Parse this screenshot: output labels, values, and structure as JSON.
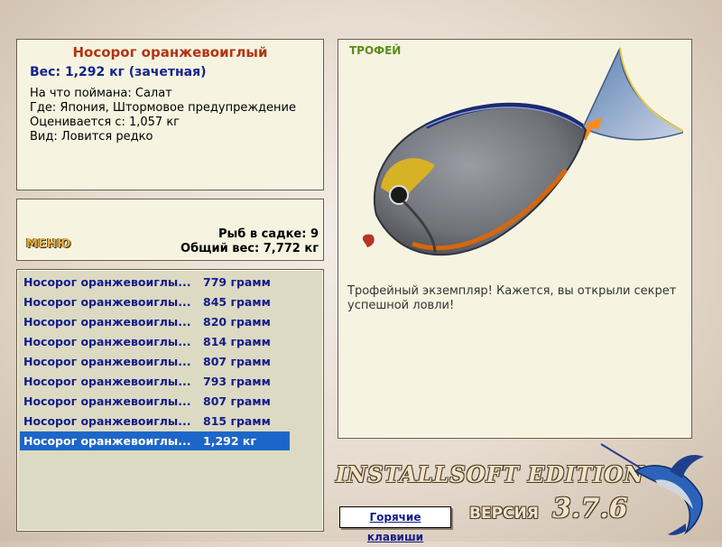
{
  "fish_info": {
    "title": "Носорог оранжевоиглый",
    "weight": "Вес: 1,292 кг (зачетная)",
    "lines": [
      "На что поймана: Салат",
      "Где: Япония, Штормовое предупреждение",
      "Оценивается с: 1,057 кг",
      "Вид: Ловится редко"
    ]
  },
  "menu": {
    "label": "МЕНЮ",
    "fish_in_cage": "Рыб в садке: 9",
    "total_weight": "Общий вес: 7,772 кг"
  },
  "catch_list": [
    {
      "name": "Носорог оранжевоиглы...",
      "weight": "779 грамм"
    },
    {
      "name": "Носорог оранжевоиглы...",
      "weight": "845 грамм"
    },
    {
      "name": "Носорог оранжевоиглы...",
      "weight": "820 грамм"
    },
    {
      "name": "Носорог оранжевоиглы...",
      "weight": "814 грамм"
    },
    {
      "name": "Носорог оранжевоиглы...",
      "weight": "807 грамм"
    },
    {
      "name": "Носорог оранжевоиглы...",
      "weight": "793 грамм"
    },
    {
      "name": "Носорог оранжевоиглы...",
      "weight": "807 грамм"
    },
    {
      "name": "Носорог оранжевоиглы...",
      "weight": "815 грамм"
    },
    {
      "name": "Носорог оранжевоиглы...",
      "weight": "1,292 кг"
    }
  ],
  "selected_index": 8,
  "trophy": {
    "tag": "ТРОФЕЙ",
    "message": "Трофейный экземпляр! Кажется, вы открыли секрет успешной ловли!"
  },
  "footer": {
    "brand": "INSTALLSOFT EDITION",
    "hotkeys": "Горячие клавиши",
    "version_label": "ВЕРСИЯ",
    "version": "3.7.6"
  },
  "colors": {
    "panel_bg": "#f6f4e1",
    "list_bg": "#dcdac2",
    "title_red": "#b53312",
    "list_text_blue": "#131c8a",
    "selection_blue": "#1d66c9",
    "trophy_green": "#5b8d19"
  }
}
